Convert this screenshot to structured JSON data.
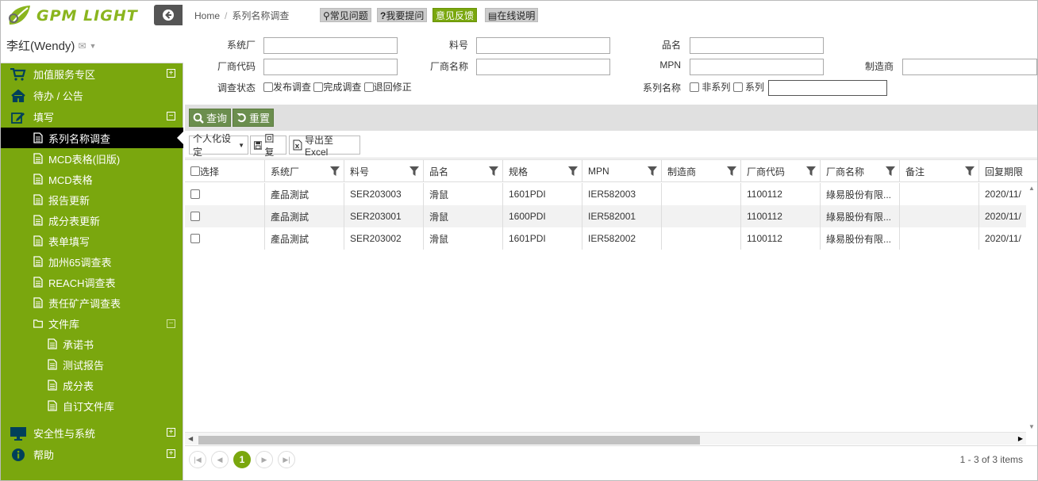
{
  "brand": {
    "logo_text": "GPM LIGHT",
    "accent": "#7aa70e"
  },
  "user": {
    "name": "李红(Wendy)"
  },
  "menu": {
    "top1": "加值服务专区",
    "top2": "待办 / 公告",
    "top3": "填写",
    "sub": [
      "系列名称调查",
      "MCD表格(旧版)",
      "MCD表格",
      "报告更新",
      "成分表更新",
      "表单填写",
      "加州65调查表",
      "REACH调查表",
      "责任矿产调查表",
      "文件库"
    ],
    "lib": [
      "承诺书",
      "测试报告",
      "成分表",
      "自订文件库"
    ],
    "bottom1": "安全性与系统",
    "bottom2": "帮助",
    "expand": "+",
    "collapse": "−"
  },
  "breadcrumb": {
    "home": "Home",
    "sep": "/",
    "current": "系列名称调查"
  },
  "top_buttons": {
    "faq": "常见问题",
    "ask": "我要提问",
    "feedback": "意见反馈",
    "help": "在线说明"
  },
  "filters": {
    "system_factory": "系统厂",
    "part_no": "料号",
    "product_name": "品名",
    "vendor_code": "厂商代码",
    "vendor_name": "厂商名称",
    "mpn": "MPN",
    "manufacturer": "制造商",
    "survey_status": "调查状态",
    "status_options": [
      "发布调查",
      "完成调查",
      "退回修正"
    ],
    "series_name": "系列名称",
    "series_options": [
      "非系列",
      "系列"
    ]
  },
  "actions": {
    "query": "查询",
    "reset": "重置"
  },
  "toolbar": {
    "personalize": "个人化设定",
    "reply": "回复",
    "export": "导出至Excel"
  },
  "grid": {
    "columns": [
      "选择",
      "系统厂",
      "料号",
      "品名",
      "规格",
      "MPN",
      "制造商",
      "厂商代码",
      "厂商名称",
      "备注",
      "回复期限"
    ],
    "rows": [
      {
        "factory": "產品測試",
        "part": "SER203003",
        "name": "滑鼠",
        "spec": "1601PDI",
        "mpn": "IER582003",
        "maker": "",
        "vcode": "1100112",
        "vname": "綠易股份有限...",
        "note": "",
        "due": "2020/11/"
      },
      {
        "factory": "產品測試",
        "part": "SER203001",
        "name": "滑鼠",
        "spec": "1600PDI",
        "mpn": "IER582001",
        "maker": "",
        "vcode": "1100112",
        "vname": "綠易股份有限...",
        "note": "",
        "due": "2020/11/"
      },
      {
        "factory": "產品測試",
        "part": "SER203002",
        "name": "滑鼠",
        "spec": "1601PDI",
        "mpn": "IER582002",
        "maker": "",
        "vcode": "1100112",
        "vname": "綠易股份有限...",
        "note": "",
        "due": "2020/11/"
      }
    ]
  },
  "pager": {
    "current_page": "1",
    "info": "1 - 3 of 3 items"
  }
}
